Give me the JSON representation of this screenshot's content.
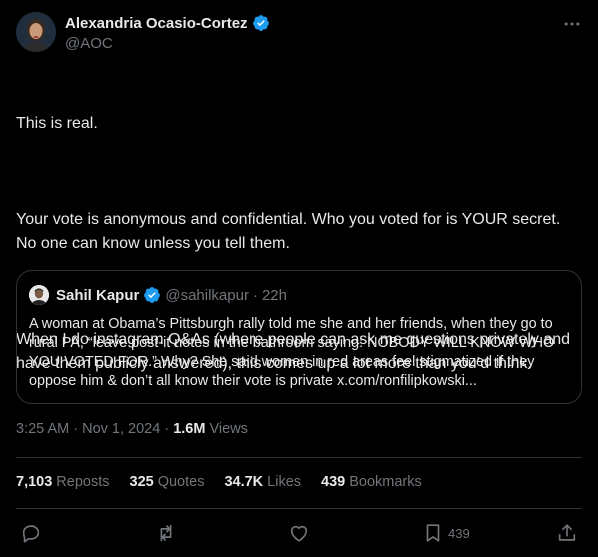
{
  "author": {
    "name": "Alexandria Ocasio-Cortez",
    "handle": "@AOC"
  },
  "tweet": {
    "paragraphs": [
      "This is real.",
      "Your vote is anonymous and confidential. Who you voted for is YOUR secret. No one can know unless you tell them.",
      "When I do instagram Q&As (where people can ask me questions privately and have them publicly answered), this comes up a lot more than you’d think."
    ]
  },
  "quote": {
    "name": "Sahil Kapur",
    "handle": "@sahilkapur",
    "dot": "·",
    "time": "22h",
    "text": "A woman at Obama’s Pittsburgh rally told me she and her friends, when they go to rural PA, “leave post-it notes in the bathroom saying: NOBODY WILL KNOW WHO YOU VOTED FOR.” Why? She said women in red areas feel stigmatized if they oppose him & don’t all know their vote is private x.com/ronfilipkowski..."
  },
  "meta": {
    "time": "3:25 AM",
    "sep": "·",
    "date": "Nov 1, 2024",
    "views_count": "1.6M",
    "views_label": "Views"
  },
  "stats": [
    {
      "num": "7,103",
      "label": "Reposts"
    },
    {
      "num": "325",
      "label": "Quotes"
    },
    {
      "num": "34.7K",
      "label": "Likes"
    },
    {
      "num": "439",
      "label": "Bookmarks"
    }
  ],
  "actions": {
    "bookmark_count": "439"
  },
  "colors": {
    "background": "#000000",
    "text": "#e7e9ea",
    "muted": "#71767b",
    "border": "#2f3336",
    "verified": "#1d9bf0"
  }
}
